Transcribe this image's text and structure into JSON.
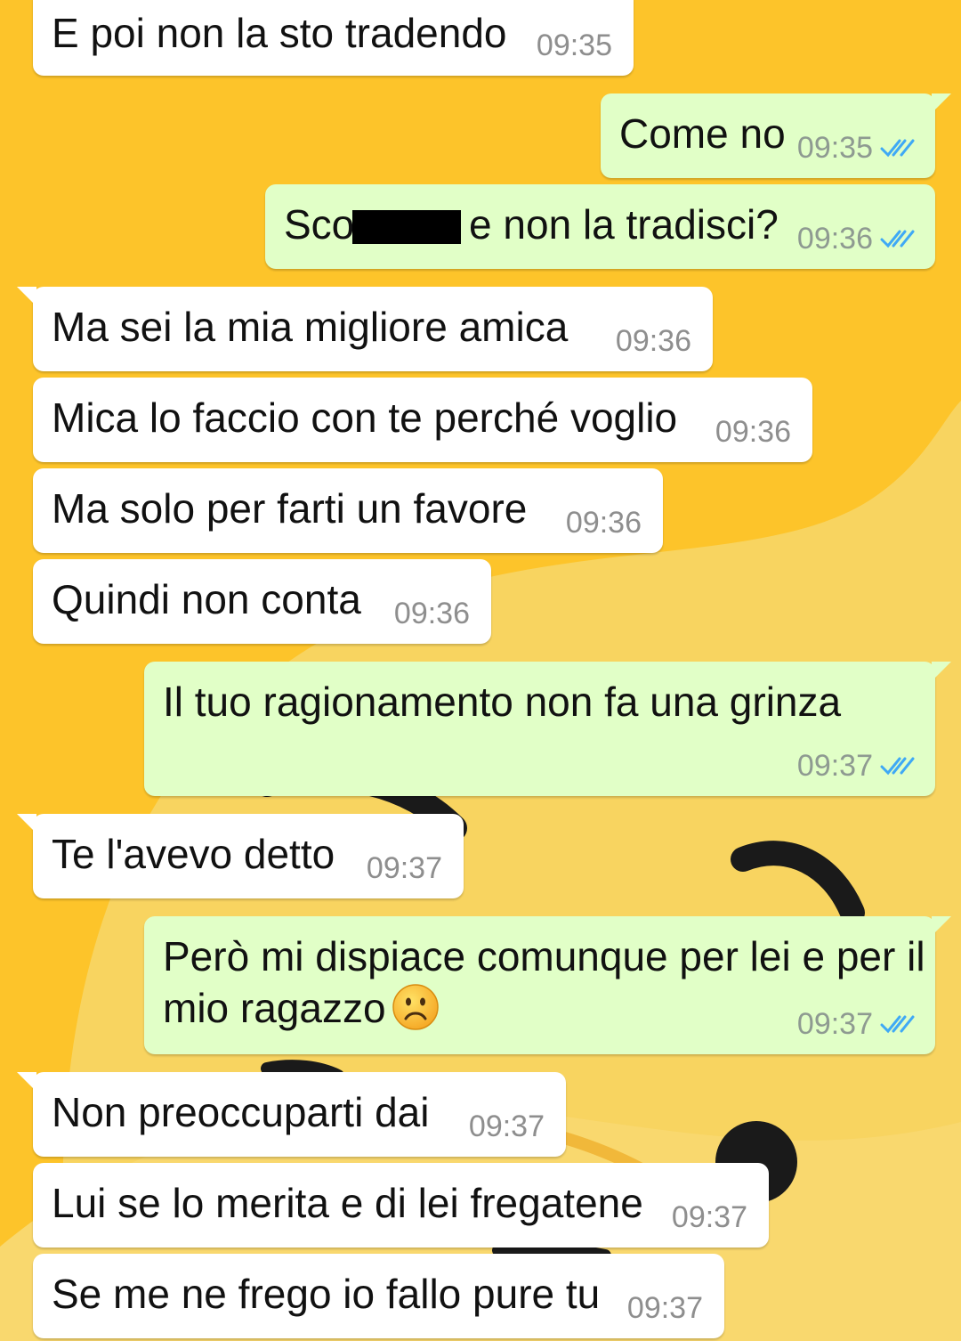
{
  "messages": [
    {
      "dir": "in",
      "text": "E poi non la sto tradendo",
      "time": "09:35"
    },
    {
      "dir": "out",
      "text": "Come no",
      "time": "09:35",
      "status": "read"
    },
    {
      "dir": "out",
      "text_before": "Sco",
      "text_after": " e non la tradisci?",
      "time": "09:36",
      "status": "read"
    },
    {
      "dir": "in",
      "text": "Ma sei la mia migliore amica",
      "time": "09:36"
    },
    {
      "dir": "in",
      "text": "Mica lo faccio con te perché voglio",
      "time": "09:36"
    },
    {
      "dir": "in",
      "text": "Ma solo per farti un favore",
      "time": "09:36"
    },
    {
      "dir": "in",
      "text": "Quindi non conta",
      "time": "09:36"
    },
    {
      "dir": "out",
      "text": "Il tuo ragionamento non fa una grinza",
      "time": "09:37",
      "status": "read"
    },
    {
      "dir": "in",
      "text": "Te l'avevo detto",
      "time": "09:37"
    },
    {
      "dir": "out",
      "line1": "Però mi dispiace comunque per lei e per il",
      "line2": "mio ragazzo",
      "emoji": "frowning-face-emoji",
      "time": "09:37",
      "status": "read"
    },
    {
      "dir": "in",
      "text": "Non preoccuparti dai",
      "time": "09:37"
    },
    {
      "dir": "in",
      "text": "Lui se lo merita e di lei fregatene",
      "time": "09:37"
    },
    {
      "dir": "in",
      "text": "Se me ne frego io fallo pure tu",
      "time": "09:37"
    }
  ],
  "colors": {
    "wallpaper": "#FDC42A",
    "incoming_bubble": "#FFFFFF",
    "outgoing_bubble": "#E1FFC7",
    "read_ticks": "#3FA9F5"
  }
}
